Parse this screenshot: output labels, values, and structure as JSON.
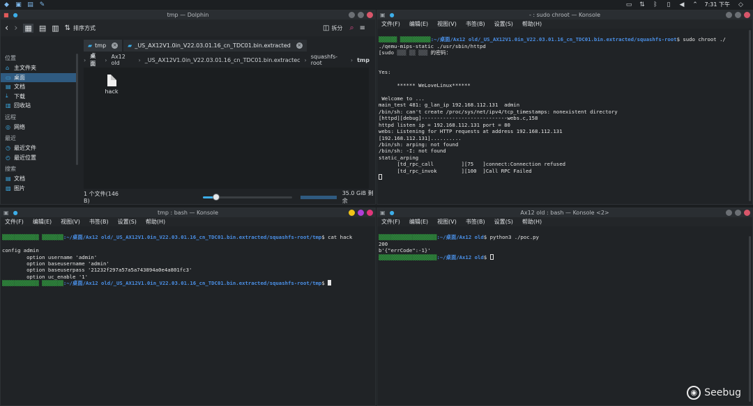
{
  "panel": {
    "clock": "7:31 下午"
  },
  "dolphin": {
    "title": "tmp — Dolphin",
    "toolbar": {
      "sort_label": "排序方式",
      "split_label": "拆分"
    },
    "sidebar": {
      "sections": [
        {
          "label": "位置",
          "items": [
            {
              "icon": "home-icon",
              "label": "主文件夹"
            },
            {
              "icon": "desktop-icon",
              "label": "桌面",
              "active": true
            },
            {
              "icon": "documents-icon",
              "label": "文档"
            },
            {
              "icon": "downloads-icon",
              "label": "下载"
            },
            {
              "icon": "trash-icon",
              "label": "回收站"
            }
          ]
        },
        {
          "label": "远程",
          "items": [
            {
              "icon": "network-icon",
              "label": "网络"
            }
          ]
        },
        {
          "label": "最近",
          "items": [
            {
              "icon": "recent-files-icon",
              "label": "最近文件"
            },
            {
              "icon": "recent-locations-icon",
              "label": "最近位置"
            }
          ]
        },
        {
          "label": "搜索",
          "items": [
            {
              "icon": "documents-icon",
              "label": "文档"
            },
            {
              "icon": "images-icon",
              "label": "图片"
            }
          ]
        }
      ]
    },
    "tabs": [
      {
        "label": "tmp",
        "active": true
      },
      {
        "label": "_US_AX12V1.0in_V22.03.01.16_cn_TDC01.bin.extracted",
        "active": false
      }
    ],
    "breadcrumb": [
      "桌面",
      "Ax12 old",
      "_US_AX12V1.0in_V22.03.01.16_cn_TDC01.bin.extractec",
      "squashfs-root",
      "tmp"
    ],
    "files": [
      {
        "name": "hack",
        "icon": "text-file-icon"
      }
    ],
    "status": {
      "count": "1 个文件(146 B)",
      "free": "35.0 GiB 剩余",
      "zoom_level": 0.15
    }
  },
  "konsole_chroot": {
    "title": "- : sudo chroot — Konsole",
    "menu": [
      "文件(F)",
      "编辑(E)",
      "视图(V)",
      "书签(B)",
      "设置(S)",
      "帮助(H)"
    ],
    "prompt_path": ":~/桌面/Ax12 old/_US_AX12V1.0in_V22.03.01.16_cn_TDC01.bin.extracted/squashfs-root",
    "command": "$ sudo chroot ./",
    "command_cont": "./qemu-mips-static ./usr/sbin/httpd",
    "sudo_prompt": "[sudo",
    "sudo_suffix": "的密码：",
    "output": [
      "",
      "",
      "Yes:",
      "",
      "      ****** WeLoveLinux******",
      "",
      " Welcome to ...",
      "main_test 481: g_lan_ip 192.168.112.131  admin",
      "/bin/sh: can't create /proc/sys/net/ipv4/tcp_timestamps: nonexistent directory",
      "[httpd][debug]----------------------------webs.c,158",
      "httpd listen ip = 192.168.112.131 port = 80",
      "webs: Listening for HTTP requests at address 192.168.112.131",
      "[192.168.112.131]..........",
      "/bin/sh: arping: not found",
      "/bin/sh: -I: not found",
      "static_arping",
      "      [td_rpc_call         ][75   ]connect:Connection refused",
      "      [td_rpc_invok        ][100  ]Call RPC Failed"
    ]
  },
  "konsole_bash": {
    "title": "tmp : bash — Konsole",
    "menu": [
      "文件(F)",
      "编辑(E)",
      "视图(V)",
      "书签(B)",
      "设置(S)",
      "帮助(H)"
    ],
    "prompt_path": ":~/桌面/Ax12 old/_US_AX12V1.0in_V22.03.01.16_cn_TDC01.bin.extracted/squashfs-root/tmp",
    "command": "$ cat hack",
    "output": [
      "",
      "config admin",
      "        option username 'admin'",
      "        option baseusername 'admin'",
      "        option baseuserpass '21232f297a57a5a743894a0e4a801fc3'",
      "        option uc_enable '1'"
    ],
    "prompt_end": "$"
  },
  "konsole_poc": {
    "title": "Ax12 old : bash — Konsole <2>",
    "menu": [
      "文件(F)",
      "编辑(E)",
      "视图(V)",
      "书签(B)",
      "设置(S)",
      "帮助(H)"
    ],
    "prompt_path": ":~/桌面/Ax12 old",
    "command": "$ python3 ./poc.py",
    "output": [
      "200",
      "b'{\"errCode\":-1}'"
    ],
    "prompt_end": "$"
  },
  "watermark": {
    "text": "Seebug"
  }
}
